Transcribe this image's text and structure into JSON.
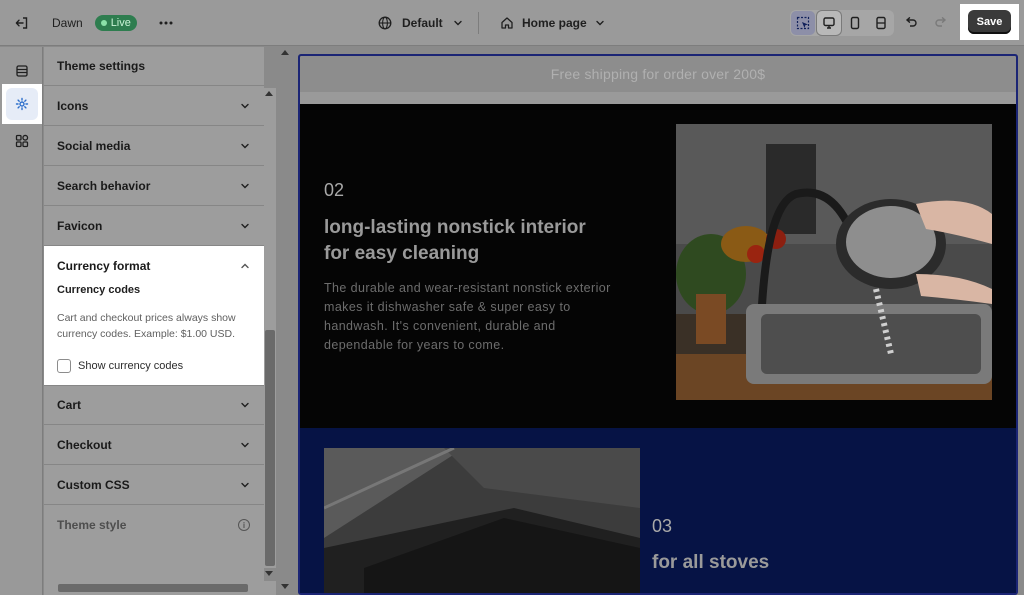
{
  "topbar": {
    "store_name": "Dawn",
    "status_badge": "Live",
    "theme_select": "Default",
    "page_select": "Home page",
    "save_label": "Save"
  },
  "sidebar": {
    "header": "Theme settings",
    "items_before": [
      {
        "label": "Icons"
      },
      {
        "label": "Social media"
      },
      {
        "label": "Search behavior"
      },
      {
        "label": "Favicon"
      }
    ],
    "open_section": {
      "label": "Currency format",
      "subtitle": "Currency codes",
      "description": "Cart and checkout prices always show currency codes. Example: $1.00 USD.",
      "checkbox_label": "Show currency codes",
      "checked": false
    },
    "items_after": [
      {
        "label": "Cart"
      },
      {
        "label": "Checkout"
      },
      {
        "label": "Custom CSS"
      }
    ],
    "theme_style_label": "Theme style"
  },
  "preview": {
    "announcement": "Free shipping for order over 200$",
    "feature1": {
      "number": "02",
      "heading_line1": "long-lasting nonstick interior",
      "heading_line2": "for easy cleaning",
      "body_line1": "The durable and wear-resistant nonstick exterior",
      "body_line2": "makes it dishwasher safe & super easy to",
      "body_line3": "handwash. It's convenient, durable and",
      "body_line4": "dependable for years to come."
    },
    "feature2": {
      "number": "03",
      "heading": "for all stoves"
    }
  },
  "colors": {
    "live_badge": "#2e7d4f",
    "save_button": "#3a3a3a",
    "active_icon": "#2c6ecb",
    "preview_border": "#1b2575",
    "section2_bg": "#061345"
  }
}
